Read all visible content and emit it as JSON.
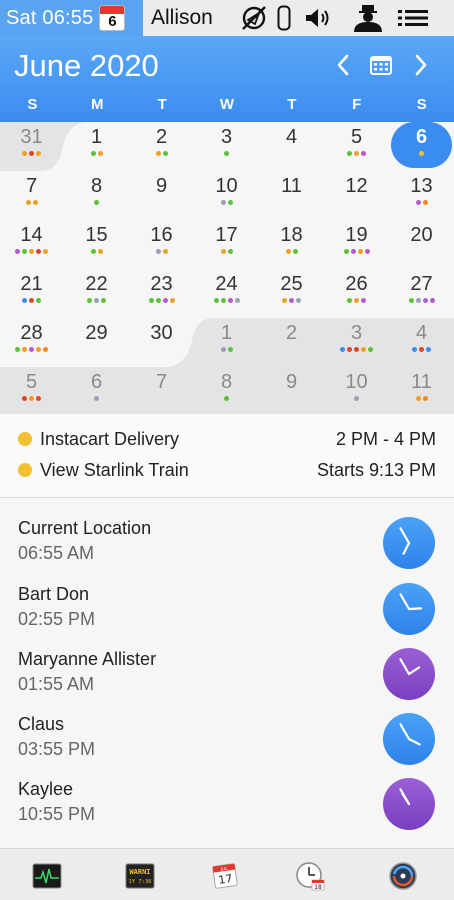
{
  "menubar": {
    "clock_text": "Sat 06:55",
    "mini_calendar_day": "6",
    "user_name": "Allison",
    "icons": [
      "no-location-icon",
      "battery-icon",
      "volume-icon",
      "user-silhouette-icon",
      "list-icon"
    ]
  },
  "calendar": {
    "month_title": "June 2020",
    "weekdays": [
      "S",
      "M",
      "T",
      "W",
      "T",
      "F",
      "S"
    ],
    "today": "6",
    "accent_color": "#3a8cf0",
    "weeks": [
      [
        {
          "n": "31",
          "other": true,
          "dots": [
            "#f0a020",
            "#e0442f",
            "#f0a020"
          ]
        },
        {
          "n": "1",
          "dots": [
            "#5bc236",
            "#f0a020"
          ]
        },
        {
          "n": "2",
          "dots": [
            "#f0a020",
            "#5bc236"
          ]
        },
        {
          "n": "3",
          "dots": [
            "#5bc236"
          ]
        },
        {
          "n": "4",
          "dots": []
        },
        {
          "n": "5",
          "dots": [
            "#5bc236",
            "#f0a020",
            "#b45ccf"
          ]
        },
        {
          "n": "6",
          "today": true,
          "dots": [
            "#f0a020"
          ]
        }
      ],
      [
        {
          "n": "7",
          "dots": [
            "#f0a020",
            "#f0a020"
          ]
        },
        {
          "n": "8",
          "dots": [
            "#5bc236"
          ]
        },
        {
          "n": "9",
          "dots": []
        },
        {
          "n": "10",
          "dots": [
            "#9aa0b0",
            "#5bc236"
          ]
        },
        {
          "n": "11",
          "dots": []
        },
        {
          "n": "12",
          "dots": []
        },
        {
          "n": "13",
          "dots": [
            "#b45ccf",
            "#f08a20"
          ]
        }
      ],
      [
        {
          "n": "14",
          "dots": [
            "#b45ccf",
            "#5bc236",
            "#f0a020",
            "#e0442f",
            "#f0a020"
          ]
        },
        {
          "n": "15",
          "dots": [
            "#5bc236",
            "#f0a020"
          ]
        },
        {
          "n": "16",
          "dots": [
            "#9aa0b0",
            "#f0a020"
          ]
        },
        {
          "n": "17",
          "dots": [
            "#f0a020",
            "#5bc236"
          ]
        },
        {
          "n": "18",
          "dots": [
            "#f0a020",
            "#5bc236"
          ]
        },
        {
          "n": "19",
          "dots": [
            "#5bc236",
            "#b45ccf",
            "#f0a020",
            "#b45ccf"
          ]
        },
        {
          "n": "20",
          "dots": []
        }
      ],
      [
        {
          "n": "21",
          "dots": [
            "#3a8cf0",
            "#e0442f",
            "#5bc236"
          ]
        },
        {
          "n": "22",
          "dots": [
            "#5bc236",
            "#9aa0b0",
            "#5bc236"
          ]
        },
        {
          "n": "23",
          "dots": [
            "#5bc236",
            "#5bc236",
            "#b45ccf",
            "#f0a020"
          ]
        },
        {
          "n": "24",
          "dots": [
            "#5bc236",
            "#5bc236",
            "#b45ccf",
            "#9aa0b0"
          ]
        },
        {
          "n": "25",
          "dots": [
            "#f0a020",
            "#b45ccf",
            "#9aa0b0"
          ]
        },
        {
          "n": "26",
          "dots": [
            "#5bc236",
            "#f0a020",
            "#b45ccf"
          ]
        },
        {
          "n": "27",
          "dots": [
            "#5bc236",
            "#9aa0b0",
            "#b45ccf",
            "#b45ccf"
          ]
        }
      ],
      [
        {
          "n": "28",
          "dots": [
            "#5bc236",
            "#f0a020",
            "#b45ccf",
            "#f0a020",
            "#f08a20"
          ]
        },
        {
          "n": "29",
          "dots": []
        },
        {
          "n": "30",
          "dots": []
        },
        {
          "n": "1",
          "other": true,
          "dots": [
            "#9aa0b0",
            "#5bc236"
          ]
        },
        {
          "n": "2",
          "other": true,
          "dots": []
        },
        {
          "n": "3",
          "other": true,
          "dots": [
            "#3a8cf0",
            "#e0442f",
            "#e0442f",
            "#f0a020",
            "#5bc236"
          ]
        },
        {
          "n": "4",
          "other": true,
          "dots": [
            "#3a8cf0",
            "#e0442f",
            "#3a8cf0"
          ]
        }
      ],
      [
        {
          "n": "5",
          "other": true,
          "dots": [
            "#e0442f",
            "#f0a020",
            "#e0442f"
          ]
        },
        {
          "n": "6",
          "other": true,
          "dots": [
            "#9aa0b0"
          ]
        },
        {
          "n": "7",
          "other": true,
          "dots": []
        },
        {
          "n": "8",
          "other": true,
          "dots": [
            "#5bc236"
          ]
        },
        {
          "n": "9",
          "other": true,
          "dots": []
        },
        {
          "n": "10",
          "other": true,
          "dots": [
            "#9aa0b0"
          ]
        },
        {
          "n": "11",
          "other": true,
          "dots": [
            "#f0a020",
            "#f08a20"
          ]
        }
      ]
    ]
  },
  "events": [
    {
      "title": "Instacart Delivery",
      "time": "2 PM - 4 PM",
      "color": "#f2c030"
    },
    {
      "title": "View Starlink Train",
      "time": "Starts 9:13 PM",
      "color": "#f2c030"
    }
  ],
  "clocks": [
    {
      "name": "Current Location",
      "time": "06:55 AM",
      "face": "blue",
      "hour": 6.9,
      "minute": 55
    },
    {
      "name": "Bart Don",
      "time": "02:55 PM",
      "face": "blue",
      "hour": 2.9,
      "minute": 55
    },
    {
      "name": "Maryanne Allister",
      "time": "01:55 AM",
      "face": "purple",
      "hour": 1.9,
      "minute": 55
    },
    {
      "name": "Claus",
      "time": "03:55 PM",
      "face": "blue",
      "hour": 3.9,
      "minute": 55
    },
    {
      "name": "Kaylee",
      "time": "10:55 PM",
      "face": "purple",
      "hour": 10.9,
      "minute": 55
    }
  ],
  "dock": {
    "items": [
      "activity-monitor-icon",
      "console-warning-icon",
      "calendar-app-icon",
      "clock-app-icon",
      "disk-diag-icon"
    ],
    "warning_label": "WARNI",
    "warning_sub": "1Y 7:36",
    "calendar_day": "17",
    "calendar_month": "JUL",
    "clock_day": "18"
  }
}
